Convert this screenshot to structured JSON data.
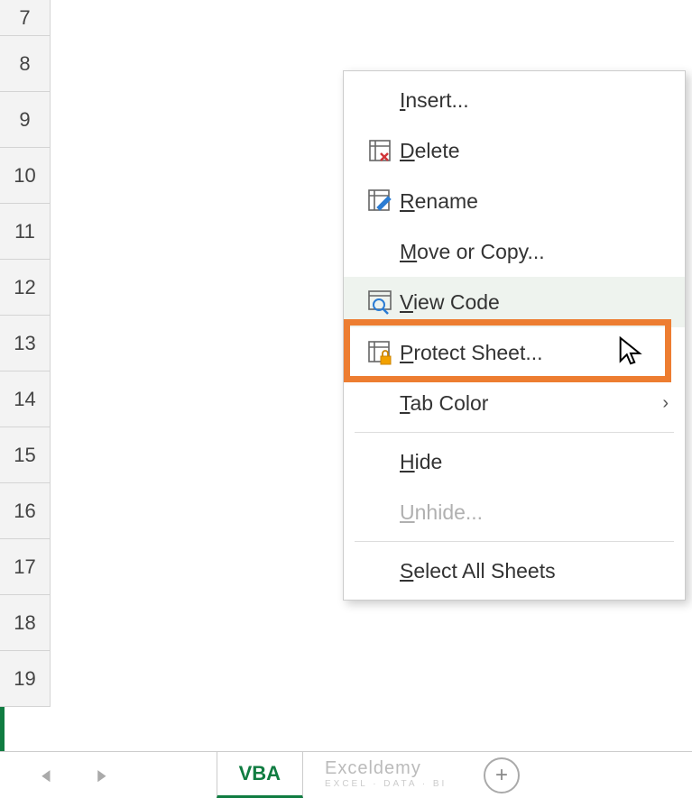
{
  "rows": [
    "7",
    "8",
    "9",
    "10",
    "11",
    "12",
    "13",
    "14",
    "15",
    "16",
    "17",
    "18",
    "19"
  ],
  "sheet": {
    "active_tab": "VBA"
  },
  "watermark": {
    "brand": "Exceldemy",
    "tag": "EXCEL · DATA · BI"
  },
  "menu": {
    "insert": {
      "label": "Insert...",
      "ul": "I"
    },
    "delete": {
      "label": "Delete",
      "ul": "D"
    },
    "rename": {
      "label": "Rename",
      "ul": "R"
    },
    "move_copy": {
      "label": "Move or Copy...",
      "ul": "M"
    },
    "view_code": {
      "label": "View Code",
      "ul": "V"
    },
    "protect": {
      "label": "Protect Sheet...",
      "ul": "P"
    },
    "tab_color": {
      "label": "Tab Color",
      "ul": "T"
    },
    "hide": {
      "label": "Hide",
      "ul": "H"
    },
    "unhide": {
      "label": "Unhide...",
      "ul": "U"
    },
    "select_all": {
      "label": "Select All Sheets",
      "ul": "S"
    }
  },
  "nav": {
    "prev": "◄",
    "next": "►"
  }
}
